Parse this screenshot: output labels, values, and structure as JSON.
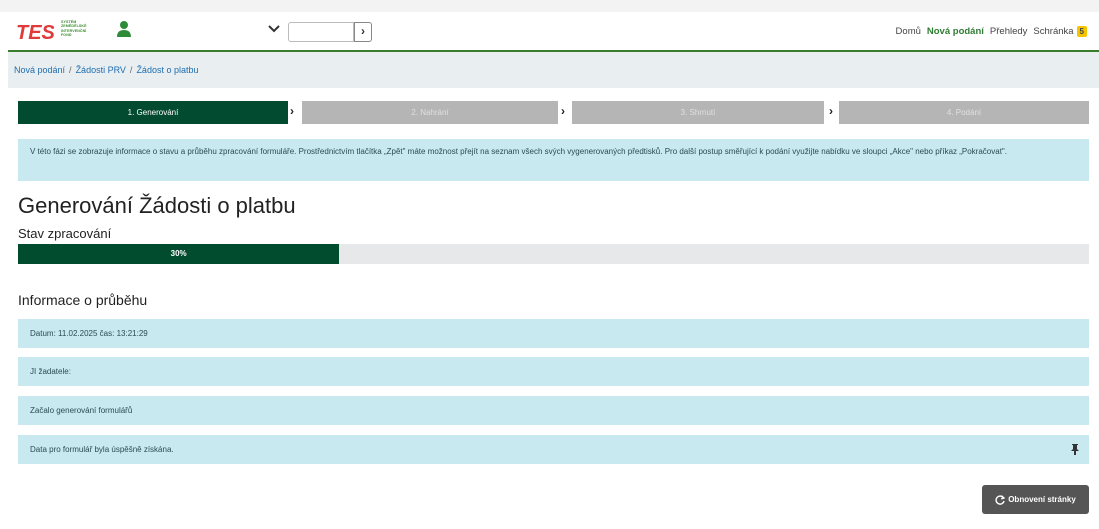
{
  "header": {
    "logo_text": "TEST",
    "logo_subtext": [
      "SYSTÉM",
      "ZEMĚDĚLSKÉ",
      "INTERVENČNÍ",
      "FOND"
    ],
    "nav": [
      {
        "label": "Domů",
        "active": false
      },
      {
        "label": "Nová podání",
        "active": true
      },
      {
        "label": "Přehledy",
        "active": false
      },
      {
        "label": "Schránka",
        "active": false
      }
    ],
    "inbox_count": "5"
  },
  "breadcrumb": [
    "Nová podání",
    "Žádosti PRV",
    "Žádost o platbu"
  ],
  "steps": [
    {
      "label": "1. Generování",
      "active": true
    },
    {
      "label": "2. Nahrání",
      "active": false
    },
    {
      "label": "3. Shrnutí",
      "active": false
    },
    {
      "label": "4. Podání",
      "active": false
    }
  ],
  "info_text": "V této fázi se zobrazuje informace o stavu a průběhu zpracování formuláře. Prostřednictvím tlačítka „Zpět\" máte možnost přejít na seznam všech svých vygenerovaných předtisků. Pro další postup směřující k podání využijte nabídku ve sloupci „Akce\" nebo příkaz „Pokračovat\".",
  "page_title": "Generování Žádosti o platbu",
  "status_label": "Stav zpracování",
  "progress": {
    "value": 30,
    "label": "30%"
  },
  "progress_section_title": "Informace o průběhu",
  "log_rows": [
    "Datum: 11.02.2025 čas: 13:21:29",
    "JI žadatele:",
    "Začalo generování formulářů",
    "Data pro formulář byla úspěšně získána."
  ],
  "refresh_label": "Obnovení stránky",
  "colors": {
    "primary": "#024a30",
    "info_bg": "#c9e9f0",
    "accent_green": "#2e7d32",
    "badge": "#f5c400"
  }
}
